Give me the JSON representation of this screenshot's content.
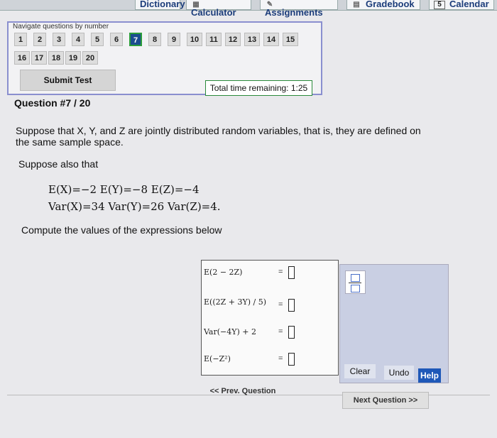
{
  "tabs": [
    {
      "name": "dictionary",
      "label": "Dictionary",
      "icon": "book-icon"
    },
    {
      "name": "calculator",
      "label": "Calculator",
      "icon": "calculator-icon"
    },
    {
      "name": "assignments",
      "label": "Assignments",
      "icon": "pencil-icon"
    },
    {
      "name": "gradebook",
      "label": "Gradebook",
      "icon": "grid-icon"
    },
    {
      "name": "calendar",
      "label": "Calendar",
      "icon": "calendar-icon",
      "icon_text": "5"
    }
  ],
  "nav": {
    "title": "Navigate questions by number",
    "row1": [
      "1",
      "2",
      "3",
      "4",
      "5",
      "6",
      "7",
      "8",
      "9",
      "10",
      "11",
      "12",
      "13",
      "14",
      "15"
    ],
    "row2": [
      "16",
      "17",
      "18",
      "19",
      "20"
    ],
    "current": "7",
    "submit_label": "Submit Test",
    "timer_label": "Total time remaining: 1:25"
  },
  "question": {
    "heading": "Question #7 / 20",
    "intro_line1": "Suppose that X, Y, and Z are jointly distributed random variables, that is, they are defined on",
    "intro_line2": "the same sample space.",
    "suppose": "Suppose also that",
    "expect_line": "E(X)=−2   E(Y)=−8   E(Z)=−4",
    "var_line": "Var(X)=34  Var(Y)=26  Var(Z)=4.",
    "compute": "Compute the values of the expressions below"
  },
  "expressions": [
    {
      "expr": "E(2 − 2Z)",
      "eq": "="
    },
    {
      "expr": "E((2Z + 3Y) / 5)",
      "eq": "="
    },
    {
      "expr": "Var(−4Y) + 2",
      "eq": "="
    },
    {
      "expr": "E(−Z²)",
      "eq": "="
    }
  ],
  "panel": {
    "clear_label": "Clear",
    "undo_label": "Undo",
    "help_label": "Help"
  },
  "footer": {
    "prev_label": "<< Prev. Question",
    "next_label": "Next Question >>"
  }
}
